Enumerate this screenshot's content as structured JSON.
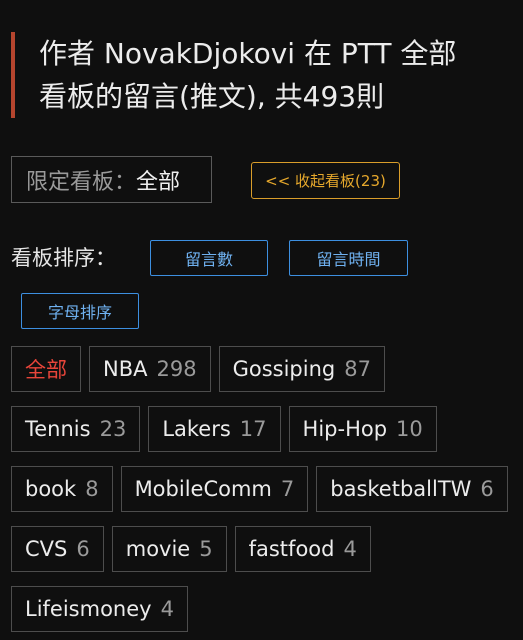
{
  "header": {
    "line1": "作者 NovakDjokovi 在 PTT 全部",
    "line2": "看板的留言(推文), 共493則"
  },
  "filter": {
    "label": "限定看板：",
    "value": "全部"
  },
  "collapse_button": "<< 收起看板(23)",
  "sort": {
    "label": "看板排序：",
    "options": [
      "留言數",
      "留言時間",
      "字母排序"
    ]
  },
  "boards": [
    {
      "name": "全部",
      "count": ""
    },
    {
      "name": "NBA",
      "count": "298"
    },
    {
      "name": "Gossiping",
      "count": "87"
    },
    {
      "name": "Tennis",
      "count": "23"
    },
    {
      "name": "Lakers",
      "count": "17"
    },
    {
      "name": "Hip-Hop",
      "count": "10"
    },
    {
      "name": "book",
      "count": "8"
    },
    {
      "name": "MobileComm",
      "count": "7"
    },
    {
      "name": "basketballTW",
      "count": "6"
    },
    {
      "name": "CVS",
      "count": "6"
    },
    {
      "name": "movie",
      "count": "5"
    },
    {
      "name": "fastfood",
      "count": "4"
    },
    {
      "name": "Lifeismoney",
      "count": "4"
    }
  ],
  "colors": {
    "accent_bar": "#b5452e",
    "collapse": "#e6a82c",
    "sort_button": "#3d8fe0",
    "active_tag": "#e8453a"
  }
}
